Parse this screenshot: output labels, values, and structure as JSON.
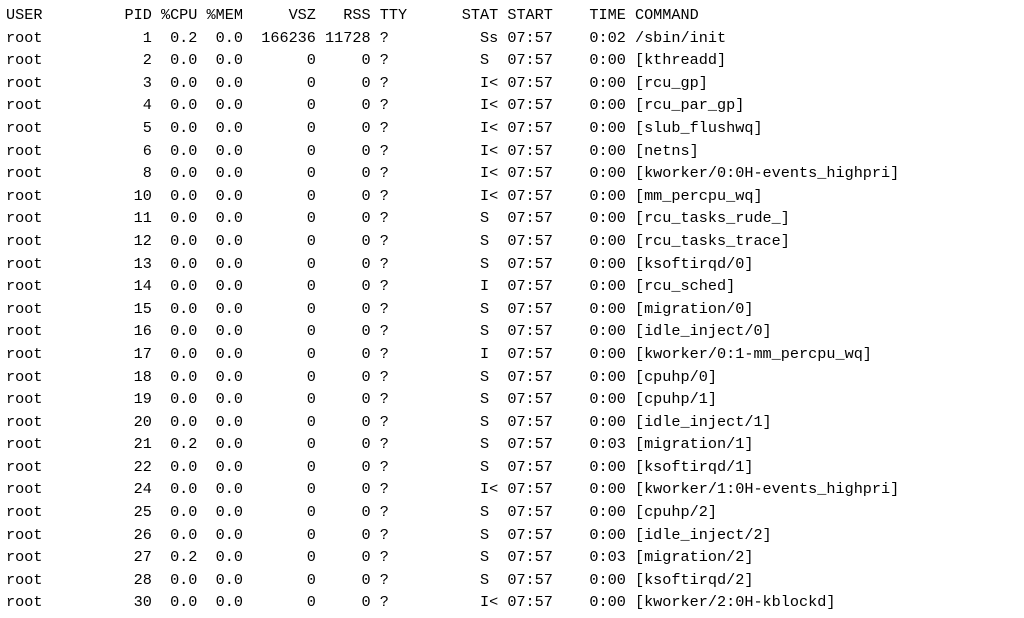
{
  "terminal": {
    "columns": [
      {
        "key": "user",
        "label": "USER",
        "width": 8,
        "align": "left"
      },
      {
        "key": "pid",
        "label": "PID",
        "width": 8,
        "align": "right"
      },
      {
        "key": "cpu",
        "label": "%CPU",
        "width": 5,
        "align": "right"
      },
      {
        "key": "mem",
        "label": "%MEM",
        "width": 5,
        "align": "right"
      },
      {
        "key": "vsz",
        "label": "VSZ",
        "width": 8,
        "align": "right"
      },
      {
        "key": "rss",
        "label": "RSS",
        "width": 6,
        "align": "right"
      },
      {
        "key": "tty",
        "label": "TTY",
        "width": 4,
        "align": "left",
        "pad_left": 1
      },
      {
        "key": "stat",
        "label": "STAT",
        "width": 9,
        "align": "right"
      },
      {
        "key": "start",
        "label": "START",
        "width": 6,
        "align": "left",
        "pad_left": 1
      },
      {
        "key": "time",
        "label": "TIME",
        "width": 7,
        "align": "right"
      },
      {
        "key": "command",
        "label": "COMMAND",
        "width": 0,
        "align": "left",
        "pad_left": 1
      }
    ],
    "rows": [
      {
        "user": "root",
        "pid": "1",
        "cpu": "0.2",
        "mem": "0.0",
        "vsz": "166236",
        "rss": "11728",
        "tty": "?",
        "stat": "Ss",
        "start": "07:57",
        "time": "0:02",
        "command": "/sbin/init"
      },
      {
        "user": "root",
        "pid": "2",
        "cpu": "0.0",
        "mem": "0.0",
        "vsz": "0",
        "rss": "0",
        "tty": "?",
        "stat": "S",
        "start": "07:57",
        "time": "0:00",
        "command": "[kthreadd]"
      },
      {
        "user": "root",
        "pid": "3",
        "cpu": "0.0",
        "mem": "0.0",
        "vsz": "0",
        "rss": "0",
        "tty": "?",
        "stat": "I<",
        "start": "07:57",
        "time": "0:00",
        "command": "[rcu_gp]"
      },
      {
        "user": "root",
        "pid": "4",
        "cpu": "0.0",
        "mem": "0.0",
        "vsz": "0",
        "rss": "0",
        "tty": "?",
        "stat": "I<",
        "start": "07:57",
        "time": "0:00",
        "command": "[rcu_par_gp]"
      },
      {
        "user": "root",
        "pid": "5",
        "cpu": "0.0",
        "mem": "0.0",
        "vsz": "0",
        "rss": "0",
        "tty": "?",
        "stat": "I<",
        "start": "07:57",
        "time": "0:00",
        "command": "[slub_flushwq]"
      },
      {
        "user": "root",
        "pid": "6",
        "cpu": "0.0",
        "mem": "0.0",
        "vsz": "0",
        "rss": "0",
        "tty": "?",
        "stat": "I<",
        "start": "07:57",
        "time": "0:00",
        "command": "[netns]"
      },
      {
        "user": "root",
        "pid": "8",
        "cpu": "0.0",
        "mem": "0.0",
        "vsz": "0",
        "rss": "0",
        "tty": "?",
        "stat": "I<",
        "start": "07:57",
        "time": "0:00",
        "command": "[kworker/0:0H-events_highpri]"
      },
      {
        "user": "root",
        "pid": "10",
        "cpu": "0.0",
        "mem": "0.0",
        "vsz": "0",
        "rss": "0",
        "tty": "?",
        "stat": "I<",
        "start": "07:57",
        "time": "0:00",
        "command": "[mm_percpu_wq]"
      },
      {
        "user": "root",
        "pid": "11",
        "cpu": "0.0",
        "mem": "0.0",
        "vsz": "0",
        "rss": "0",
        "tty": "?",
        "stat": "S",
        "start": "07:57",
        "time": "0:00",
        "command": "[rcu_tasks_rude_]"
      },
      {
        "user": "root",
        "pid": "12",
        "cpu": "0.0",
        "mem": "0.0",
        "vsz": "0",
        "rss": "0",
        "tty": "?",
        "stat": "S",
        "start": "07:57",
        "time": "0:00",
        "command": "[rcu_tasks_trace]"
      },
      {
        "user": "root",
        "pid": "13",
        "cpu": "0.0",
        "mem": "0.0",
        "vsz": "0",
        "rss": "0",
        "tty": "?",
        "stat": "S",
        "start": "07:57",
        "time": "0:00",
        "command": "[ksoftirqd/0]"
      },
      {
        "user": "root",
        "pid": "14",
        "cpu": "0.0",
        "mem": "0.0",
        "vsz": "0",
        "rss": "0",
        "tty": "?",
        "stat": "I",
        "start": "07:57",
        "time": "0:00",
        "command": "[rcu_sched]"
      },
      {
        "user": "root",
        "pid": "15",
        "cpu": "0.0",
        "mem": "0.0",
        "vsz": "0",
        "rss": "0",
        "tty": "?",
        "stat": "S",
        "start": "07:57",
        "time": "0:00",
        "command": "[migration/0]"
      },
      {
        "user": "root",
        "pid": "16",
        "cpu": "0.0",
        "mem": "0.0",
        "vsz": "0",
        "rss": "0",
        "tty": "?",
        "stat": "S",
        "start": "07:57",
        "time": "0:00",
        "command": "[idle_inject/0]"
      },
      {
        "user": "root",
        "pid": "17",
        "cpu": "0.0",
        "mem": "0.0",
        "vsz": "0",
        "rss": "0",
        "tty": "?",
        "stat": "I",
        "start": "07:57",
        "time": "0:00",
        "command": "[kworker/0:1-mm_percpu_wq]"
      },
      {
        "user": "root",
        "pid": "18",
        "cpu": "0.0",
        "mem": "0.0",
        "vsz": "0",
        "rss": "0",
        "tty": "?",
        "stat": "S",
        "start": "07:57",
        "time": "0:00",
        "command": "[cpuhp/0]"
      },
      {
        "user": "root",
        "pid": "19",
        "cpu": "0.0",
        "mem": "0.0",
        "vsz": "0",
        "rss": "0",
        "tty": "?",
        "stat": "S",
        "start": "07:57",
        "time": "0:00",
        "command": "[cpuhp/1]"
      },
      {
        "user": "root",
        "pid": "20",
        "cpu": "0.0",
        "mem": "0.0",
        "vsz": "0",
        "rss": "0",
        "tty": "?",
        "stat": "S",
        "start": "07:57",
        "time": "0:00",
        "command": "[idle_inject/1]"
      },
      {
        "user": "root",
        "pid": "21",
        "cpu": "0.2",
        "mem": "0.0",
        "vsz": "0",
        "rss": "0",
        "tty": "?",
        "stat": "S",
        "start": "07:57",
        "time": "0:03",
        "command": "[migration/1]"
      },
      {
        "user": "root",
        "pid": "22",
        "cpu": "0.0",
        "mem": "0.0",
        "vsz": "0",
        "rss": "0",
        "tty": "?",
        "stat": "S",
        "start": "07:57",
        "time": "0:00",
        "command": "[ksoftirqd/1]"
      },
      {
        "user": "root",
        "pid": "24",
        "cpu": "0.0",
        "mem": "0.0",
        "vsz": "0",
        "rss": "0",
        "tty": "?",
        "stat": "I<",
        "start": "07:57",
        "time": "0:00",
        "command": "[kworker/1:0H-events_highpri]"
      },
      {
        "user": "root",
        "pid": "25",
        "cpu": "0.0",
        "mem": "0.0",
        "vsz": "0",
        "rss": "0",
        "tty": "?",
        "stat": "S",
        "start": "07:57",
        "time": "0:00",
        "command": "[cpuhp/2]"
      },
      {
        "user": "root",
        "pid": "26",
        "cpu": "0.0",
        "mem": "0.0",
        "vsz": "0",
        "rss": "0",
        "tty": "?",
        "stat": "S",
        "start": "07:57",
        "time": "0:00",
        "command": "[idle_inject/2]"
      },
      {
        "user": "root",
        "pid": "27",
        "cpu": "0.2",
        "mem": "0.0",
        "vsz": "0",
        "rss": "0",
        "tty": "?",
        "stat": "S",
        "start": "07:57",
        "time": "0:03",
        "command": "[migration/2]"
      },
      {
        "user": "root",
        "pid": "28",
        "cpu": "0.0",
        "mem": "0.0",
        "vsz": "0",
        "rss": "0",
        "tty": "?",
        "stat": "S",
        "start": "07:57",
        "time": "0:00",
        "command": "[ksoftirqd/2]"
      },
      {
        "user": "root",
        "pid": "30",
        "cpu": "0.0",
        "mem": "0.0",
        "vsz": "0",
        "rss": "0",
        "tty": "?",
        "stat": "I<",
        "start": "07:57",
        "time": "0:00",
        "command": "[kworker/2:0H-kblockd]"
      }
    ]
  }
}
